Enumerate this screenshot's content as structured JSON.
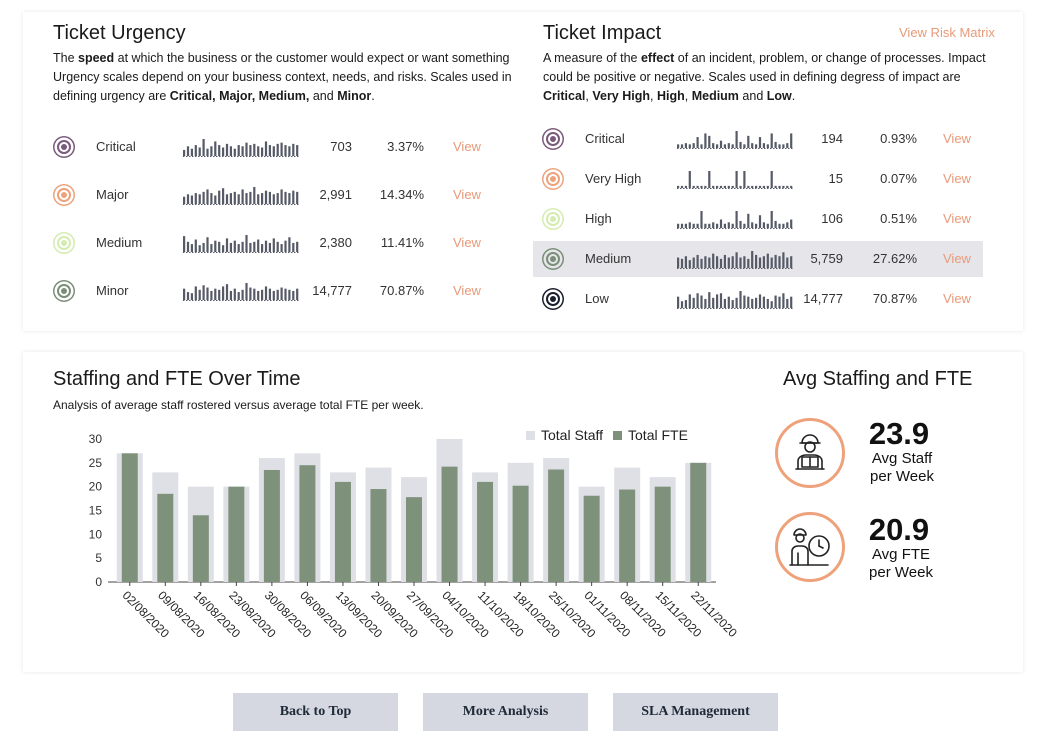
{
  "urgency": {
    "title": "Ticket Urgency",
    "desc_pre": "The ",
    "desc_bold": "speed",
    "desc_mid": " at which the business or the customer would expect or want something Urgency scales depend on your business context, needs, and risks. Scales used in defining urgency are ",
    "desc_levels": "Critical, Major, Medium,",
    "desc_and": " and ",
    "desc_last": "Minor",
    "desc_end": ".",
    "rows": [
      {
        "label": "Critical",
        "count": "703",
        "pct": "3.37%",
        "view": "View",
        "color": "#7a5a7c",
        "spark": [
          5,
          8,
          6,
          9,
          7,
          14,
          6,
          8,
          12,
          9,
          7,
          10,
          8,
          6,
          9,
          8,
          11,
          9,
          10,
          8,
          7,
          12,
          9,
          8,
          10,
          11,
          9,
          8,
          10,
          9
        ]
      },
      {
        "label": "Major",
        "count": "2,991",
        "pct": "14.34%",
        "view": "View",
        "color": "#eea27c",
        "spark": [
          6,
          8,
          7,
          9,
          8,
          10,
          12,
          9,
          7,
          11,
          13,
          8,
          9,
          10,
          8,
          12,
          9,
          10,
          14,
          8,
          9,
          11,
          10,
          8,
          9,
          12,
          10,
          9,
          11,
          10
        ]
      },
      {
        "label": "Medium",
        "count": "2,380",
        "pct": "11.41%",
        "view": "View",
        "color": "#d4ecb0",
        "spark": [
          14,
          9,
          7,
          11,
          6,
          8,
          13,
          7,
          10,
          9,
          6,
          12,
          8,
          10,
          7,
          9,
          15,
          8,
          9,
          11,
          7,
          10,
          8,
          12,
          9,
          7,
          10,
          13,
          8,
          9
        ]
      },
      {
        "label": "Minor",
        "count": "14,777",
        "pct": "70.87%",
        "view": "View",
        "color": "#7a8e78",
        "spark": [
          10,
          7,
          6,
          12,
          9,
          13,
          11,
          8,
          10,
          9,
          12,
          14,
          8,
          10,
          7,
          9,
          15,
          11,
          10,
          8,
          9,
          12,
          10,
          8,
          9,
          11,
          10,
          9,
          8,
          10
        ]
      }
    ]
  },
  "impact": {
    "title": "Ticket Impact",
    "risk_link": "View Risk Matrix",
    "desc_pre": "A measure of the ",
    "desc_bold": "effect",
    "desc_mid": " of an incident, problem, or change of processes. Impact could be positive or negative. Scales used in defining degress of impact are ",
    "desc_l1": "Critical",
    "desc_c1": ", ",
    "desc_l2": "Very High",
    "desc_c2": ", ",
    "desc_l3": "High",
    "desc_c3": ", ",
    "desc_l4": "Medium",
    "desc_and": " and ",
    "desc_l5": "Low",
    "desc_end": ".",
    "rows": [
      {
        "label": "Critical",
        "count": "194",
        "pct": "0.93%",
        "view": "View",
        "color": "#7a5a7c",
        "highlight": false,
        "spark": [
          3,
          3,
          4,
          3,
          4,
          9,
          3,
          12,
          10,
          4,
          3,
          6,
          3,
          4,
          3,
          14,
          5,
          3,
          10,
          4,
          3,
          9,
          4,
          3,
          12,
          5,
          3,
          3,
          4,
          12
        ]
      },
      {
        "label": "Very High",
        "count": "15",
        "pct": "0.07%",
        "view": "View",
        "color": "#eea27c",
        "highlight": false,
        "spark": [
          2,
          2,
          2,
          16,
          2,
          2,
          2,
          2,
          16,
          2,
          2,
          2,
          2,
          2,
          2,
          16,
          2,
          16,
          2,
          2,
          2,
          2,
          2,
          2,
          16,
          2,
          2,
          2,
          2,
          2
        ]
      },
      {
        "label": "High",
        "count": "106",
        "pct": "0.51%",
        "view": "View",
        "color": "#d4ecb0",
        "highlight": false,
        "spark": [
          3,
          3,
          3,
          4,
          3,
          3,
          12,
          3,
          3,
          4,
          3,
          6,
          3,
          4,
          3,
          12,
          5,
          3,
          10,
          4,
          3,
          9,
          4,
          3,
          12,
          5,
          3,
          3,
          4,
          6
        ]
      },
      {
        "label": "Medium",
        "count": "5,759",
        "pct": "27.62%",
        "view": "View",
        "color": "#7a8e78",
        "highlight": true,
        "spark": [
          8,
          7,
          9,
          6,
          8,
          10,
          7,
          9,
          8,
          11,
          9,
          7,
          10,
          8,
          9,
          12,
          8,
          9,
          7,
          13,
          10,
          8,
          9,
          11,
          8,
          10,
          9,
          12,
          8,
          9
        ]
      },
      {
        "label": "Low",
        "count": "14,777",
        "pct": "70.87%",
        "view": "View",
        "color": "#1a1f2e",
        "highlight": false,
        "spark": [
          10,
          6,
          7,
          12,
          9,
          13,
          11,
          8,
          14,
          9,
          12,
          13,
          8,
          10,
          7,
          9,
          15,
          11,
          10,
          8,
          9,
          12,
          10,
          8,
          6,
          11,
          10,
          13,
          8,
          10
        ]
      }
    ]
  },
  "staffing": {
    "title": "Staffing and FTE Over Time",
    "subtitle": "Analysis of average staff rostered versus average total FTE per week."
  },
  "avg": {
    "title": "Avg Staffing and FTE",
    "staff_value": "23.9",
    "staff_label_1": "Avg Staff",
    "staff_label_2": "per Week",
    "fte_value": "20.9",
    "fte_label_1": "Avg FTE",
    "fte_label_2": "per Week",
    "icon_staff": "delivery-person-icon",
    "icon_fte": "person-clock-icon"
  },
  "chart_data": {
    "type": "bar",
    "categories": [
      "02/08/2020",
      "09/08/2020",
      "16/08/2020",
      "23/08/2020",
      "30/08/2020",
      "06/09/2020",
      "13/09/2020",
      "20/09/2020",
      "27/09/2020",
      "04/10/2020",
      "11/10/2020",
      "18/10/2020",
      "25/10/2020",
      "01/11/2020",
      "08/11/2020",
      "15/11/2020",
      "22/11/2020"
    ],
    "series": [
      {
        "name": "Total Staff",
        "color": "#dfe0e6",
        "values": [
          27,
          23,
          20,
          20,
          26,
          27,
          23,
          24,
          22,
          30,
          23,
          25,
          26,
          20,
          24,
          22,
          25
        ]
      },
      {
        "name": "Total FTE",
        "color": "#7d917b",
        "values": [
          27,
          18.5,
          14,
          20,
          23.5,
          24.5,
          21,
          19.5,
          17.8,
          24.2,
          21,
          20.2,
          23.6,
          18.1,
          19.4,
          20,
          25
        ]
      }
    ],
    "ylim": [
      0,
      30
    ],
    "yticks": [
      0,
      5,
      10,
      15,
      20,
      25,
      30
    ],
    "legend": "top-right",
    "grid": false
  },
  "buttons": {
    "back_top": "Back to Top",
    "more_analysis": "More Analysis",
    "sla": "SLA Management"
  }
}
